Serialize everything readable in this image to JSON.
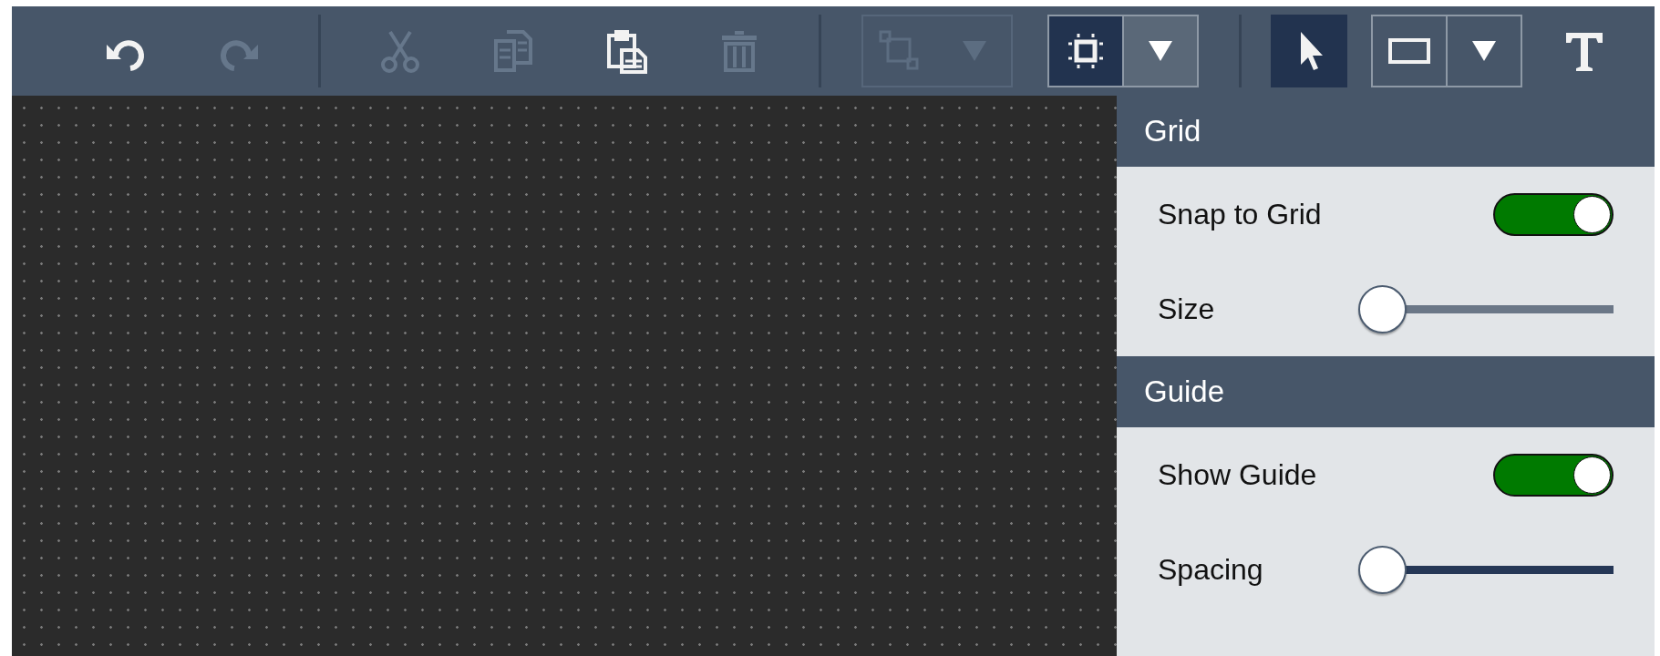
{
  "toolbar": {
    "items": [
      {
        "kind": "button",
        "disabled": false,
        "selected": false
      },
      {
        "kind": "button",
        "disabled": true,
        "selected": false
      },
      {
        "kind": "separator"
      },
      {
        "kind": "button",
        "disabled": true,
        "selected": false
      },
      {
        "kind": "button",
        "disabled": true,
        "selected": false
      },
      {
        "kind": "button",
        "disabled": false,
        "selected": false
      },
      {
        "kind": "button",
        "disabled": true,
        "selected": false
      },
      {
        "kind": "separator"
      },
      {
        "kind": "split",
        "disabled": true,
        "selected": false
      },
      {
        "kind": "split",
        "disabled": false,
        "selected": true
      },
      {
        "kind": "separator"
      },
      {
        "kind": "button",
        "disabled": false,
        "selected": true
      },
      {
        "kind": "split",
        "disabled": false,
        "selected": false
      },
      {
        "kind": "button",
        "disabled": false,
        "selected": false
      }
    ]
  },
  "panel": {
    "sections": [
      {
        "title": "Grid",
        "rows": [
          {
            "kind": "toggle",
            "label": "Snap to Grid",
            "on": true
          },
          {
            "kind": "slider",
            "label": "Size",
            "level": 0,
            "color": "#6b7787"
          }
        ]
      },
      {
        "title": "Guide",
        "rows": [
          {
            "kind": "toggle",
            "label": "Show Guide",
            "on": true
          },
          {
            "kind": "slider",
            "label": "Spacing",
            "level": 0,
            "color": "#253756"
          }
        ]
      }
    ]
  }
}
